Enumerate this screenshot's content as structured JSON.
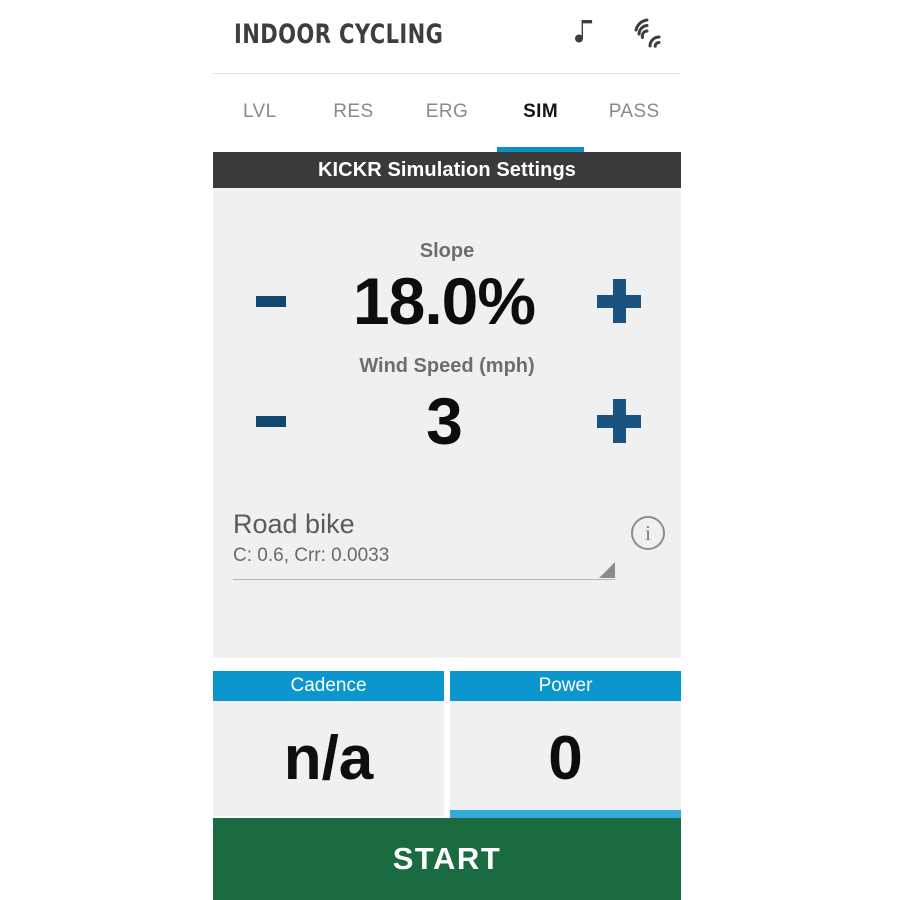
{
  "header": {
    "title": "INDOOR CYCLING",
    "icons": [
      {
        "name": "music-note-icon",
        "glyph": "♪"
      },
      {
        "name": "sensors-signal-icon",
        "glyph": "signal"
      }
    ]
  },
  "tabs": [
    {
      "label": "LVL",
      "active": false
    },
    {
      "label": "RES",
      "active": false
    },
    {
      "label": "ERG",
      "active": false
    },
    {
      "label": "SIM",
      "active": true
    },
    {
      "label": "PASS",
      "active": false
    }
  ],
  "settings": {
    "header_title": "KICKR Simulation Settings",
    "slope": {
      "label": "Slope",
      "value": "18.0%",
      "decrement_label": "-",
      "increment_label": "+"
    },
    "wind": {
      "label": "Wind Speed (mph)",
      "value": "3",
      "decrement_label": "-",
      "increment_label": "+"
    },
    "bike_profile": {
      "name": "Road bike",
      "coefficients": "C: 0.6, Crr: 0.0033",
      "info_label": "i"
    }
  },
  "metrics": [
    {
      "title": "Cadence",
      "value": "n/a"
    },
    {
      "title": "Power",
      "value": "0"
    }
  ],
  "start": {
    "label": "START"
  },
  "colors": {
    "accent_blue": "#0b96ce",
    "tab_indicator": "#0b8fc7",
    "stepper_navy": "#1a5380",
    "header_dark": "#3a3a3a",
    "start_green": "#1b6b40",
    "panel_gray": "#f0f0f0"
  }
}
